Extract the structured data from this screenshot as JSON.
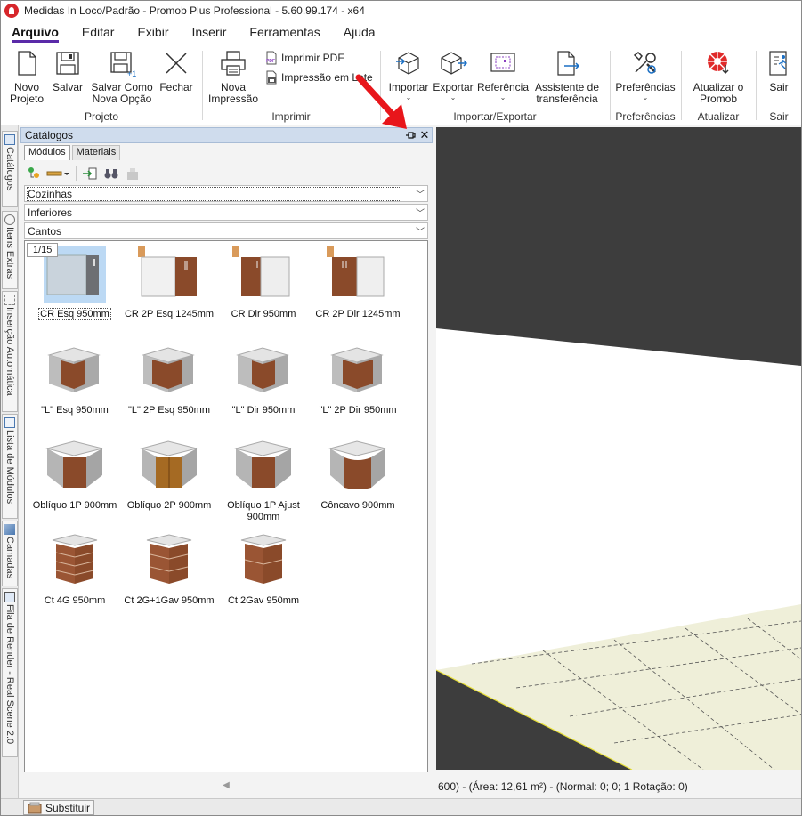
{
  "window": {
    "title": "Medidas In Loco/Padrão - Promob Plus Professional - 5.60.99.174 - x64"
  },
  "menu": {
    "tabs": [
      "Arquivo",
      "Editar",
      "Exibir",
      "Inserir",
      "Ferramentas",
      "Ajuda"
    ]
  },
  "ribbon": {
    "projeto": {
      "label": "Projeto",
      "novo": [
        "Novo",
        "Projeto"
      ],
      "salvar": "Salvar",
      "salvar_como": [
        "Salvar Como",
        "Nova Opção"
      ],
      "fechar": "Fechar"
    },
    "imprimir": {
      "label": "Imprimir",
      "nova": [
        "Nova",
        "Impressão"
      ],
      "pdf": "Imprimir PDF",
      "lote": "Impressão em Lote"
    },
    "importar_exportar": {
      "label": "Importar/Exportar",
      "importar": "Importar",
      "exportar": "Exportar",
      "referencia": "Referência",
      "assistente": [
        "Assistente de",
        "transferência"
      ]
    },
    "preferencias": {
      "label": "Preferências",
      "btn": "Preferências"
    },
    "atualizar": {
      "label": "Atualizar",
      "btn": [
        "Atualizar o",
        "Promob"
      ]
    },
    "sair": {
      "label": "Sair",
      "btn": "Sair"
    }
  },
  "side_tabs": [
    "Catálogos",
    "Itens Extras",
    "Inserção Automática",
    "Lista de Módulos",
    "Camadas",
    "Fila de Render - Real Scene 2.0"
  ],
  "panel": {
    "title": "Catálogos",
    "tabs": [
      "Módulos",
      "Materiais"
    ],
    "combos": [
      "Cozinhas",
      "Inferiores",
      "Cantos"
    ],
    "page": "1/15",
    "items": [
      "CR Esq 950mm",
      "CR 2P Esq 1245mm",
      "CR Dir 950mm",
      "CR 2P Dir 1245mm",
      "\"L\" Esq 950mm",
      "\"L\" 2P Esq 950mm",
      "\"L\" Dir 950mm",
      "\"L\" 2P Dir 950mm",
      "Oblíquo 1P 900mm",
      "Oblíquo 2P 900mm",
      "Oblíquo 1P Ajust 900mm",
      "Côncavo 900mm",
      "Ct 4G 950mm",
      "Ct 2G+1Gav 950mm",
      "Ct 2Gav 950mm"
    ]
  },
  "status": {
    "text": "600) - (Área: 12,61 m²) - (Normal: 0; 0; 1 Rotação: 0)"
  },
  "bottom": {
    "substituir": "Substituir"
  },
  "colors": {
    "accent": "#5a2aa8",
    "panel_header": "#cfdced",
    "arrow": "#e8161b",
    "wood": "#8a4a2a",
    "floor": "#efefd9"
  }
}
